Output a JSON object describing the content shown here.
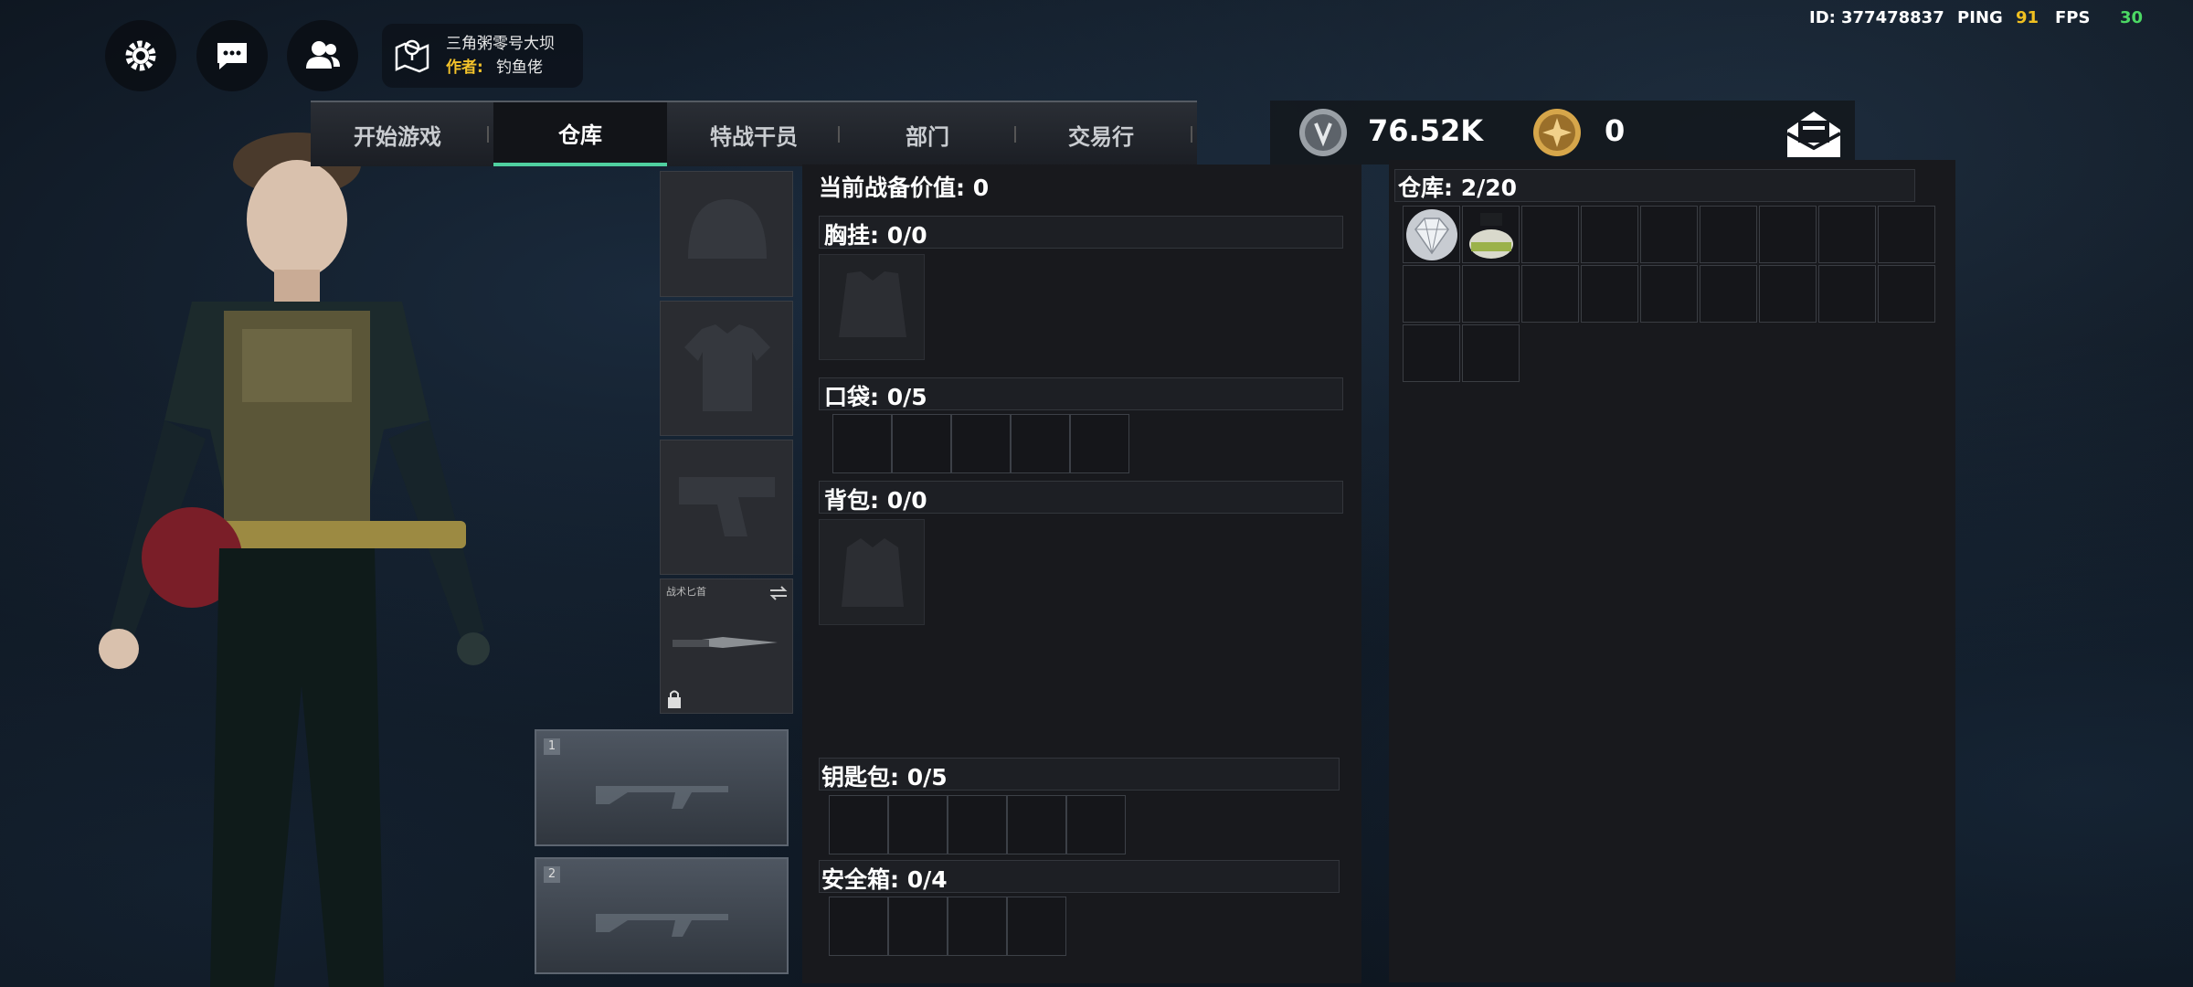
{
  "status": {
    "id_label": "ID:",
    "id_value": "377478837",
    "ping_label": "PING",
    "ping_value": "91",
    "fps_label": "FPS",
    "fps_value": "30",
    "ping_color": "#f0c020",
    "fps_color": "#4cd964"
  },
  "toolbar": {
    "settings_icon": "gear-icon",
    "chat_icon": "chat-icon",
    "friends_icon": "friends-icon",
    "map_icon": "map-pin-icon"
  },
  "map": {
    "title": "三角粥零号大坝",
    "author_label": "作者:",
    "author_name": "钓鱼佬"
  },
  "nav": {
    "tabs": [
      {
        "label": "开始游戏"
      },
      {
        "label": "仓库"
      },
      {
        "label": "特战干员"
      },
      {
        "label": "部门"
      },
      {
        "label": "交易行"
      }
    ],
    "active": "仓库"
  },
  "currency": {
    "silver": "76.52K",
    "gold": "0",
    "mail_icon": "mail-icon"
  },
  "loadout": {
    "value_label": "当前战备价值: 0",
    "chest_rig": "胸挂: 0/0",
    "pockets": "口袋: 0/5",
    "backpack": "背包: 0/0",
    "keys": "钥匙包: 0/5",
    "safe_box": "安全箱: 0/4"
  },
  "equipment": {
    "melee_label": "战术匕首",
    "weapon1_num": "1",
    "weapon2_num": "2"
  },
  "warehouse": {
    "label": "仓库: 2/20"
  }
}
